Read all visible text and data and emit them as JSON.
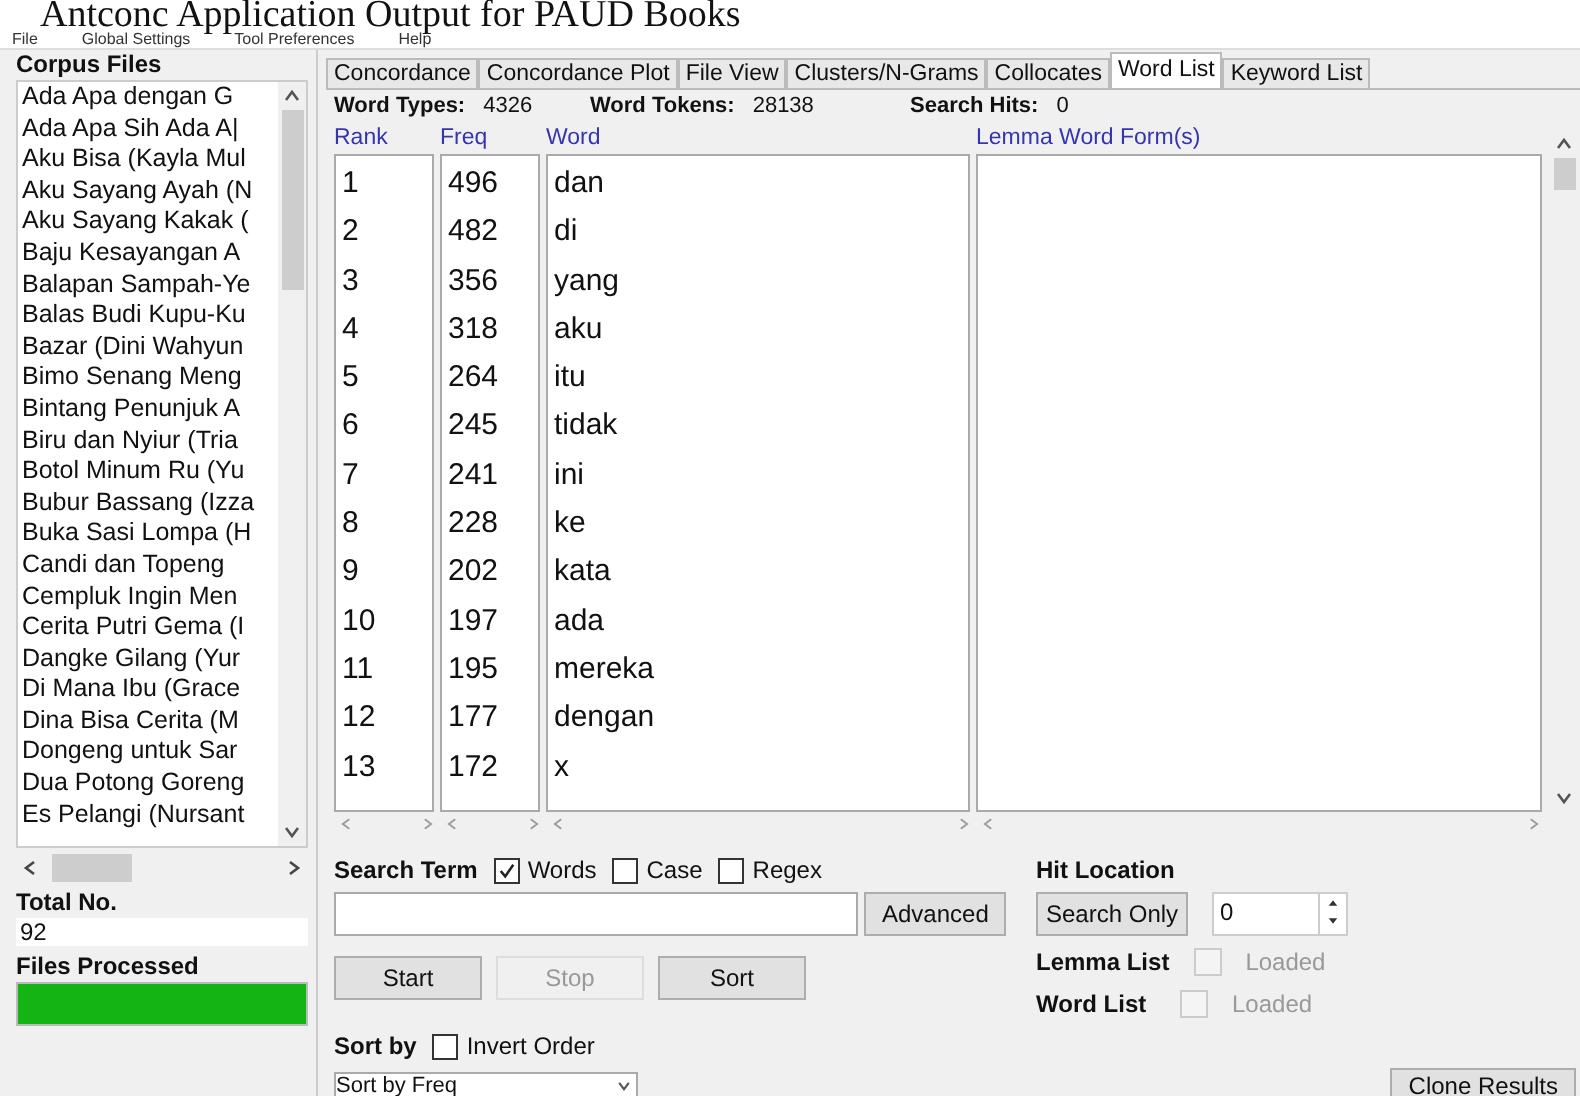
{
  "caption": "Antconc Application Output for PAUD Books",
  "menu": [
    "File",
    "Global Settings",
    "Tool Preferences",
    "Help"
  ],
  "sidebar": {
    "title": "Corpus Files",
    "files": [
      "Ada Apa dengan G",
      "Ada Apa Sih Ada A|",
      "Aku Bisa (Kayla Mul",
      "Aku Sayang Ayah (N",
      "Aku Sayang Kakak (",
      "Baju Kesayangan A",
      "Balapan Sampah-Ye",
      "Balas Budi Kupu-Ku",
      "Bazar (Dini Wahyun",
      "Bimo Senang Meng",
      "Bintang Penunjuk A",
      "Biru dan Nyiur (Tria",
      "Botol Minum Ru (Yu",
      "Bubur Bassang (Izza",
      "Buka Sasi Lompa (H",
      "Candi dan Topeng",
      "Cempluk Ingin Men",
      "Cerita Putri Gema (I",
      "Dangke Gilang (Yur",
      "Di Mana Ibu (Grace",
      "Dina Bisa Cerita (M",
      "Dongeng untuk Sar",
      "Dua Potong Goreng",
      "Es Pelangi (Nursant"
    ],
    "total_label": "Total No.",
    "total_value": "92",
    "processed_label": "Files Processed",
    "progress": {
      "level": 1
    }
  },
  "tabs": [
    {
      "label": "Concordance",
      "selected": false
    },
    {
      "label": "Concordance Plot",
      "selected": false
    },
    {
      "label": "File View",
      "selected": false
    },
    {
      "label": "Clusters/N-Grams",
      "selected": false
    },
    {
      "label": "Collocates",
      "selected": false
    },
    {
      "label": "Word List",
      "selected": true
    },
    {
      "label": "Keyword List",
      "selected": false
    }
  ],
  "stats": [
    {
      "label": "Word Types:",
      "value": "4326"
    },
    {
      "label": "Word Tokens:",
      "value": "28138"
    },
    {
      "label": "Search Hits:",
      "value": "0"
    }
  ],
  "table": {
    "columns": [
      "Rank",
      "Freq",
      "Word",
      "Lemma Word Form(s)"
    ],
    "rows": [
      [
        "1",
        "496",
        "dan"
      ],
      [
        "2",
        "482",
        "di"
      ],
      [
        "3",
        "356",
        "yang"
      ],
      [
        "4",
        "318",
        "aku"
      ],
      [
        "5",
        "264",
        "itu"
      ],
      [
        "6",
        "245",
        "tidak"
      ],
      [
        "7",
        "241",
        "ini"
      ],
      [
        "8",
        "228",
        "ke"
      ],
      [
        "9",
        "202",
        "kata"
      ],
      [
        "10",
        "197",
        "ada"
      ],
      [
        "11",
        "195",
        "mereka"
      ],
      [
        "12",
        "177",
        "dengan"
      ],
      [
        "13",
        "172",
        "x"
      ]
    ]
  },
  "search": {
    "label": "Search Term",
    "options": [
      {
        "label": "Words",
        "checked": true
      },
      {
        "label": "Case",
        "checked": false
      },
      {
        "label": "Regex",
        "checked": false
      }
    ],
    "advanced": "Advanced"
  },
  "buttons": [
    {
      "label": "Start",
      "disabled": false
    },
    {
      "label": "Stop",
      "disabled": true
    },
    {
      "label": "Sort",
      "disabled": false
    }
  ],
  "hit": {
    "label": "Hit Location",
    "button": "Search Only",
    "value": "0"
  },
  "loaded": [
    {
      "label": "Lemma List",
      "status": "Loaded",
      "checked": false
    },
    {
      "label": "Word List",
      "status": "Loaded",
      "checked": false
    }
  ],
  "sort": {
    "label": "Sort by",
    "invert": {
      "label": "Invert Order",
      "checked": false
    },
    "value": "Sort by Freq"
  },
  "clone": "Clone Results"
}
